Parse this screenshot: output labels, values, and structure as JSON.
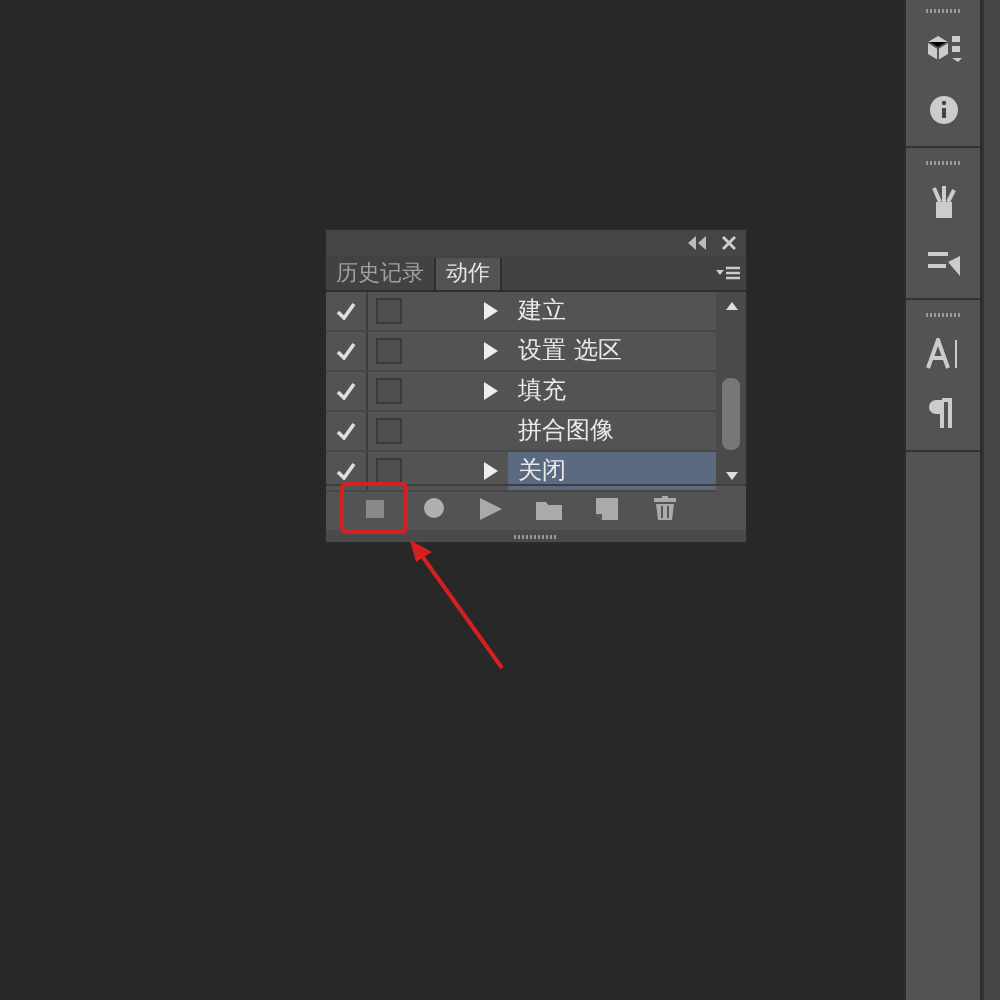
{
  "actions_panel": {
    "tabs": [
      {
        "label": "历史记录",
        "selected": false
      },
      {
        "label": "动作",
        "selected": true
      }
    ],
    "rows": [
      {
        "label": "建立",
        "checked": true,
        "expandable": true,
        "selected": false
      },
      {
        "label": "设置 选区",
        "checked": true,
        "expandable": true,
        "selected": false
      },
      {
        "label": "填充",
        "checked": true,
        "expandable": true,
        "selected": false
      },
      {
        "label": "拼合图像",
        "checked": true,
        "expandable": false,
        "selected": false
      },
      {
        "label": "关闭",
        "checked": true,
        "expandable": true,
        "selected": true
      }
    ],
    "buttons": [
      {
        "kind": "stop",
        "highlighted": true
      },
      {
        "kind": "record",
        "highlighted": false
      },
      {
        "kind": "play",
        "highlighted": false
      },
      {
        "kind": "folder",
        "highlighted": false
      },
      {
        "kind": "new",
        "highlighted": false
      },
      {
        "kind": "delete",
        "highlighted": false
      }
    ]
  },
  "dock": {
    "groups": [
      {
        "icons": [
          {
            "kind": "cube"
          },
          {
            "kind": "info"
          }
        ]
      },
      {
        "icons": [
          {
            "kind": "brushes"
          },
          {
            "kind": "presets"
          }
        ]
      },
      {
        "icons": [
          {
            "kind": "character"
          },
          {
            "kind": "paragraph"
          }
        ]
      }
    ]
  }
}
